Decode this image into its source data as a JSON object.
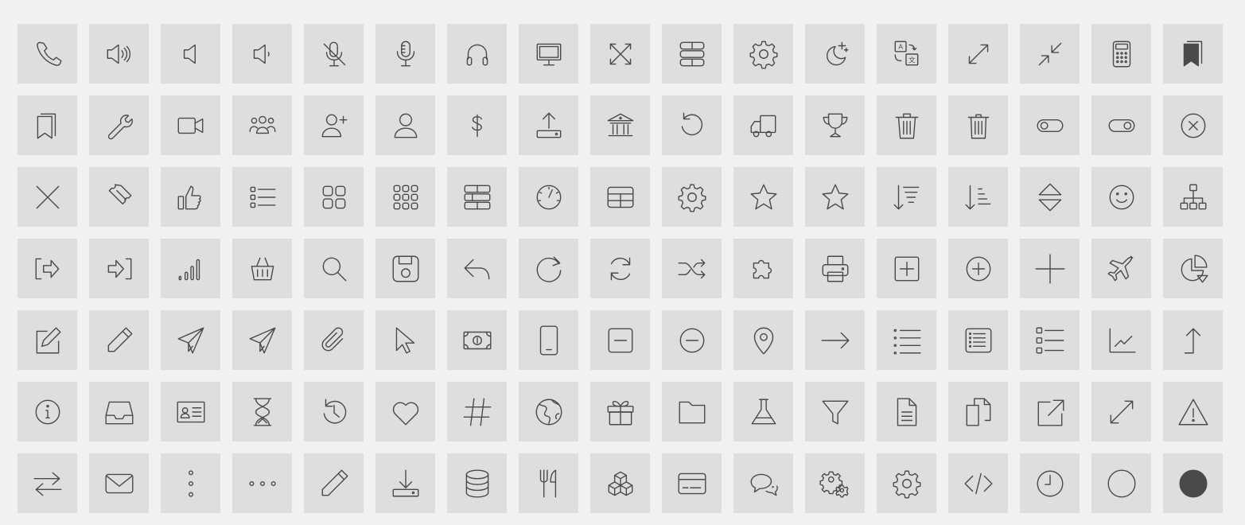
{
  "colors": {
    "background": "#f1f1f1",
    "tile": "#dedede",
    "icon_stroke": "#4a4a4a"
  },
  "icons": [
    "phone-icon",
    "volume-high-icon",
    "volume-off-icon",
    "volume-low-icon",
    "microphone-off-icon",
    "microphone-icon",
    "headphones-icon",
    "monitor-icon",
    "expand-arrows-icon",
    "database-rows-icon",
    "settings-icon",
    "night-mode-icon",
    "translate-icon",
    "fullscreen-icon",
    "exit-fullscreen-icon",
    "calculator-icon",
    "bookmarks-filled-icon",
    "bookmarks-icon",
    "wrench-icon",
    "video-camera-icon",
    "users-group-icon",
    "add-user-icon",
    "user-icon",
    "dollar-icon",
    "upload-icon",
    "bank-icon",
    "undo-icon",
    "delivery-truck-icon",
    "trophy-icon",
    "trash-icon",
    "trash-alt-icon",
    "toggle-off-icon",
    "toggle-on-icon",
    "close-circle-icon",
    "close-icon",
    "ticket-icon",
    "thumbs-up-icon",
    "list-icon",
    "grid-2x2-icon",
    "grid-3x3-icon",
    "rows-icon",
    "speedometer-icon",
    "table-icon",
    "settings-alt-icon",
    "star-icon",
    "star-alt-icon",
    "sort-descending-icon",
    "sort-ascending-icon",
    "sort-arrows-icon",
    "smiley-icon",
    "sitemap-icon",
    "sign-out-icon",
    "sign-in-icon",
    "signal-bars-icon",
    "shopping-basket-icon",
    "search-icon",
    "save-icon",
    "reply-icon",
    "redo-icon",
    "refresh-icon",
    "shuffle-icon",
    "puzzle-icon",
    "printer-icon",
    "plus-square-icon",
    "plus-circle-icon",
    "plus-icon",
    "airplane-icon",
    "pie-chart-icon",
    "edit-icon",
    "pencil-icon",
    "send-icon",
    "send-alt-icon",
    "paperclip-icon",
    "cursor-pointer-icon",
    "banknote-icon",
    "mobile-phone-icon",
    "minus-square-icon",
    "minus-circle-icon",
    "location-pin-icon",
    "arrow-right-icon",
    "bullet-list-icon",
    "list-box-icon",
    "checklist-icon",
    "line-chart-icon",
    "arrow-up-icon",
    "info-icon",
    "inbox-icon",
    "id-card-icon",
    "hourglass-icon",
    "history-icon",
    "heart-icon",
    "hashtag-icon",
    "globe-icon",
    "gift-icon",
    "folder-icon",
    "flask-icon",
    "filter-icon",
    "document-icon",
    "copy-icon",
    "external-link-icon",
    "resize-icon",
    "warning-icon",
    "transfer-icon",
    "mail-icon",
    "more-vertical-icon",
    "more-horizontal-icon",
    "pencil-alt-icon",
    "download-icon",
    "database-icon",
    "restaurant-icon",
    "cubes-icon",
    "credit-card-icon",
    "chat-icon",
    "settings-multiple-icon",
    "cog-icon",
    "code-icon",
    "clock-icon",
    "circle-outline-icon",
    "circle-filled-icon"
  ]
}
